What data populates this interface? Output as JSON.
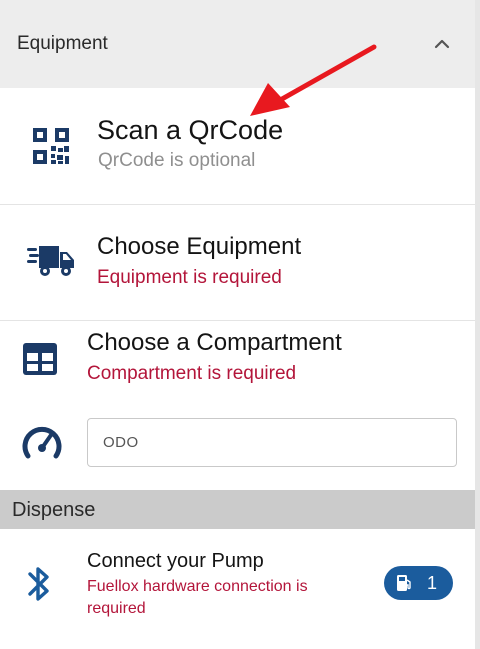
{
  "equipment_section": {
    "title": "Equipment"
  },
  "rows": {
    "qrcode": {
      "title": "Scan a QrCode",
      "subtitle": "QrCode is optional"
    },
    "equipment": {
      "title": "Choose Equipment",
      "subtitle": "Equipment is required"
    },
    "compartment": {
      "title": "Choose a Compartment",
      "subtitle": "Compartment is required"
    }
  },
  "odo": {
    "label": "ODO"
  },
  "dispense_section": {
    "title": "Dispense",
    "pump": {
      "title": "Connect your Pump",
      "subtitle": "Fuellox hardware connection is required",
      "badge_count": "1"
    }
  },
  "colors": {
    "accent": "#1b5c9d",
    "icon_navy": "#1b3a66",
    "error_red": "#b3153a",
    "annotation_arrow": "#e8191f"
  },
  "icons": [
    "chevron-up-icon",
    "qr-code-icon",
    "truck-icon",
    "table-icon",
    "speedometer-icon",
    "bluetooth-icon",
    "fuel-pump-icon"
  ]
}
